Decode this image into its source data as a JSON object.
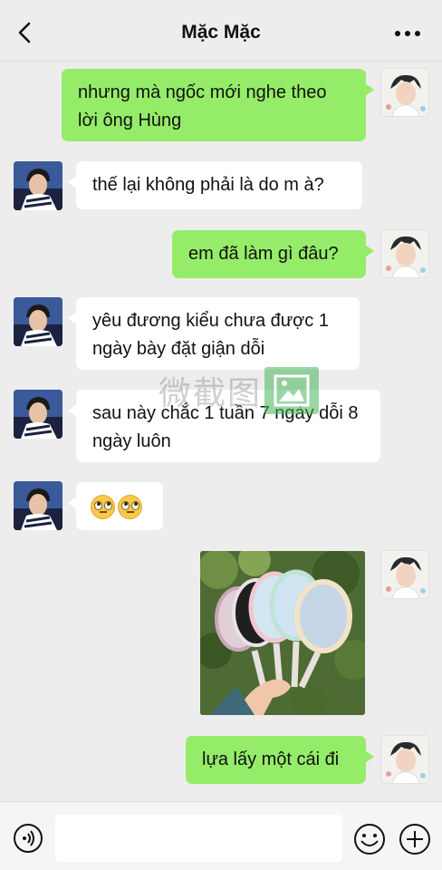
{
  "header": {
    "title": "Mặc Mặc",
    "back_icon": "chevron-left-icon",
    "more_icon": "more-dots-icon"
  },
  "colors": {
    "self_bubble": "#95ec69",
    "other_bubble": "#ffffff",
    "background": "#ededed"
  },
  "messages": [
    {
      "sender": "self",
      "type": "text",
      "text": "nhưng mà ngốc mới nghe theo lời ông Hùng"
    },
    {
      "sender": "other",
      "type": "text",
      "text": "thế lại không phải là do m à?"
    },
    {
      "sender": "self",
      "type": "text",
      "text": "em đã làm gì đâu?"
    },
    {
      "sender": "other",
      "type": "text",
      "text": "yêu đương kiểu chưa được 1 ngày bày đặt giận dỗi"
    },
    {
      "sender": "other",
      "type": "text",
      "text": "sau này chắc 1 tuần 7 ngày dỗi 8 ngày luôn"
    },
    {
      "sender": "other",
      "type": "emoji",
      "emoji": "face-with-rolling-eyes x2"
    },
    {
      "sender": "self",
      "type": "image",
      "image": "photo of hand holding pastel hand mirrors in front of green foliage"
    },
    {
      "sender": "self",
      "type": "text",
      "text": "lựa lấy một cái đi"
    }
  ],
  "watermark": {
    "text": "微截图"
  },
  "input_bar": {
    "voice_icon": "voice-icon",
    "input_value": "",
    "emoji_icon": "smile-icon",
    "plus_icon": "plus-icon"
  }
}
